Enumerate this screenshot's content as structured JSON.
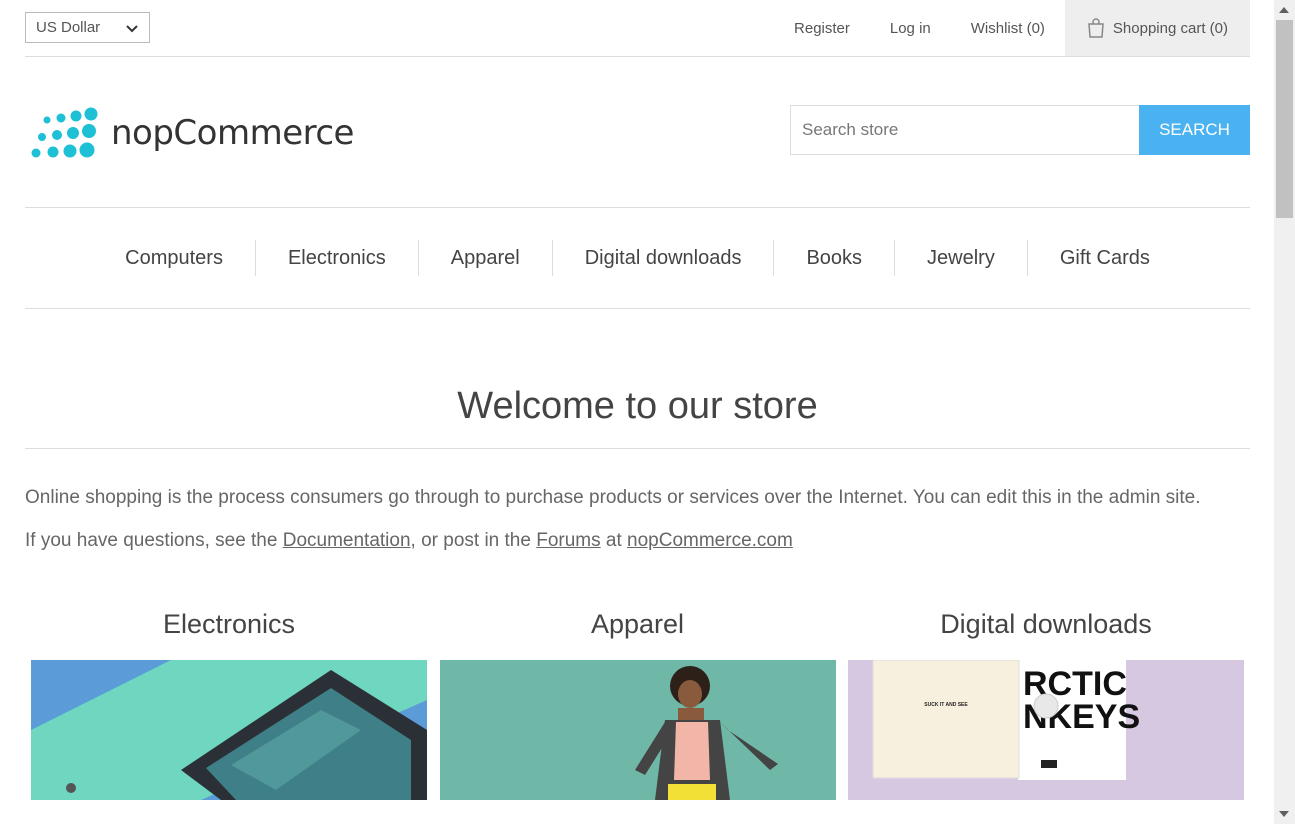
{
  "header": {
    "currency": "US Dollar",
    "links": {
      "register": "Register",
      "login": "Log in",
      "wishlist": "Wishlist (0)",
      "cart": "Shopping cart (0)"
    }
  },
  "logo": {
    "text": "nopCommerce",
    "color": "#1ec0d6"
  },
  "search": {
    "placeholder": "Search store",
    "button": "SEARCH",
    "accent": "#4ab2f1"
  },
  "menu": [
    "Computers",
    "Electronics",
    "Apparel",
    "Digital downloads",
    "Books",
    "Jewelry",
    "Gift Cards"
  ],
  "content": {
    "title": "Welcome to our store",
    "intro": "Online shopping is the process consumers go through to purchase products or services over the Internet. You can edit this in the admin site.",
    "q_prefix": "If you have questions, see the ",
    "doc_link": "Documentation",
    "q_middle": ", or post in the ",
    "forums_link": "Forums",
    "q_at": " at ",
    "site_link": "nopCommerce.com"
  },
  "categories": [
    {
      "title": "Electronics",
      "bg": "#5b9bd8"
    },
    {
      "title": "Apparel",
      "bg": "#6fb8a8"
    },
    {
      "title": "Digital downloads",
      "bg": "#d7c8e2"
    }
  ],
  "album": {
    "sleeve_text": "SUCK IT AND SEE",
    "band_line1": "RCTIC",
    "band_line2": "NKEYS"
  }
}
